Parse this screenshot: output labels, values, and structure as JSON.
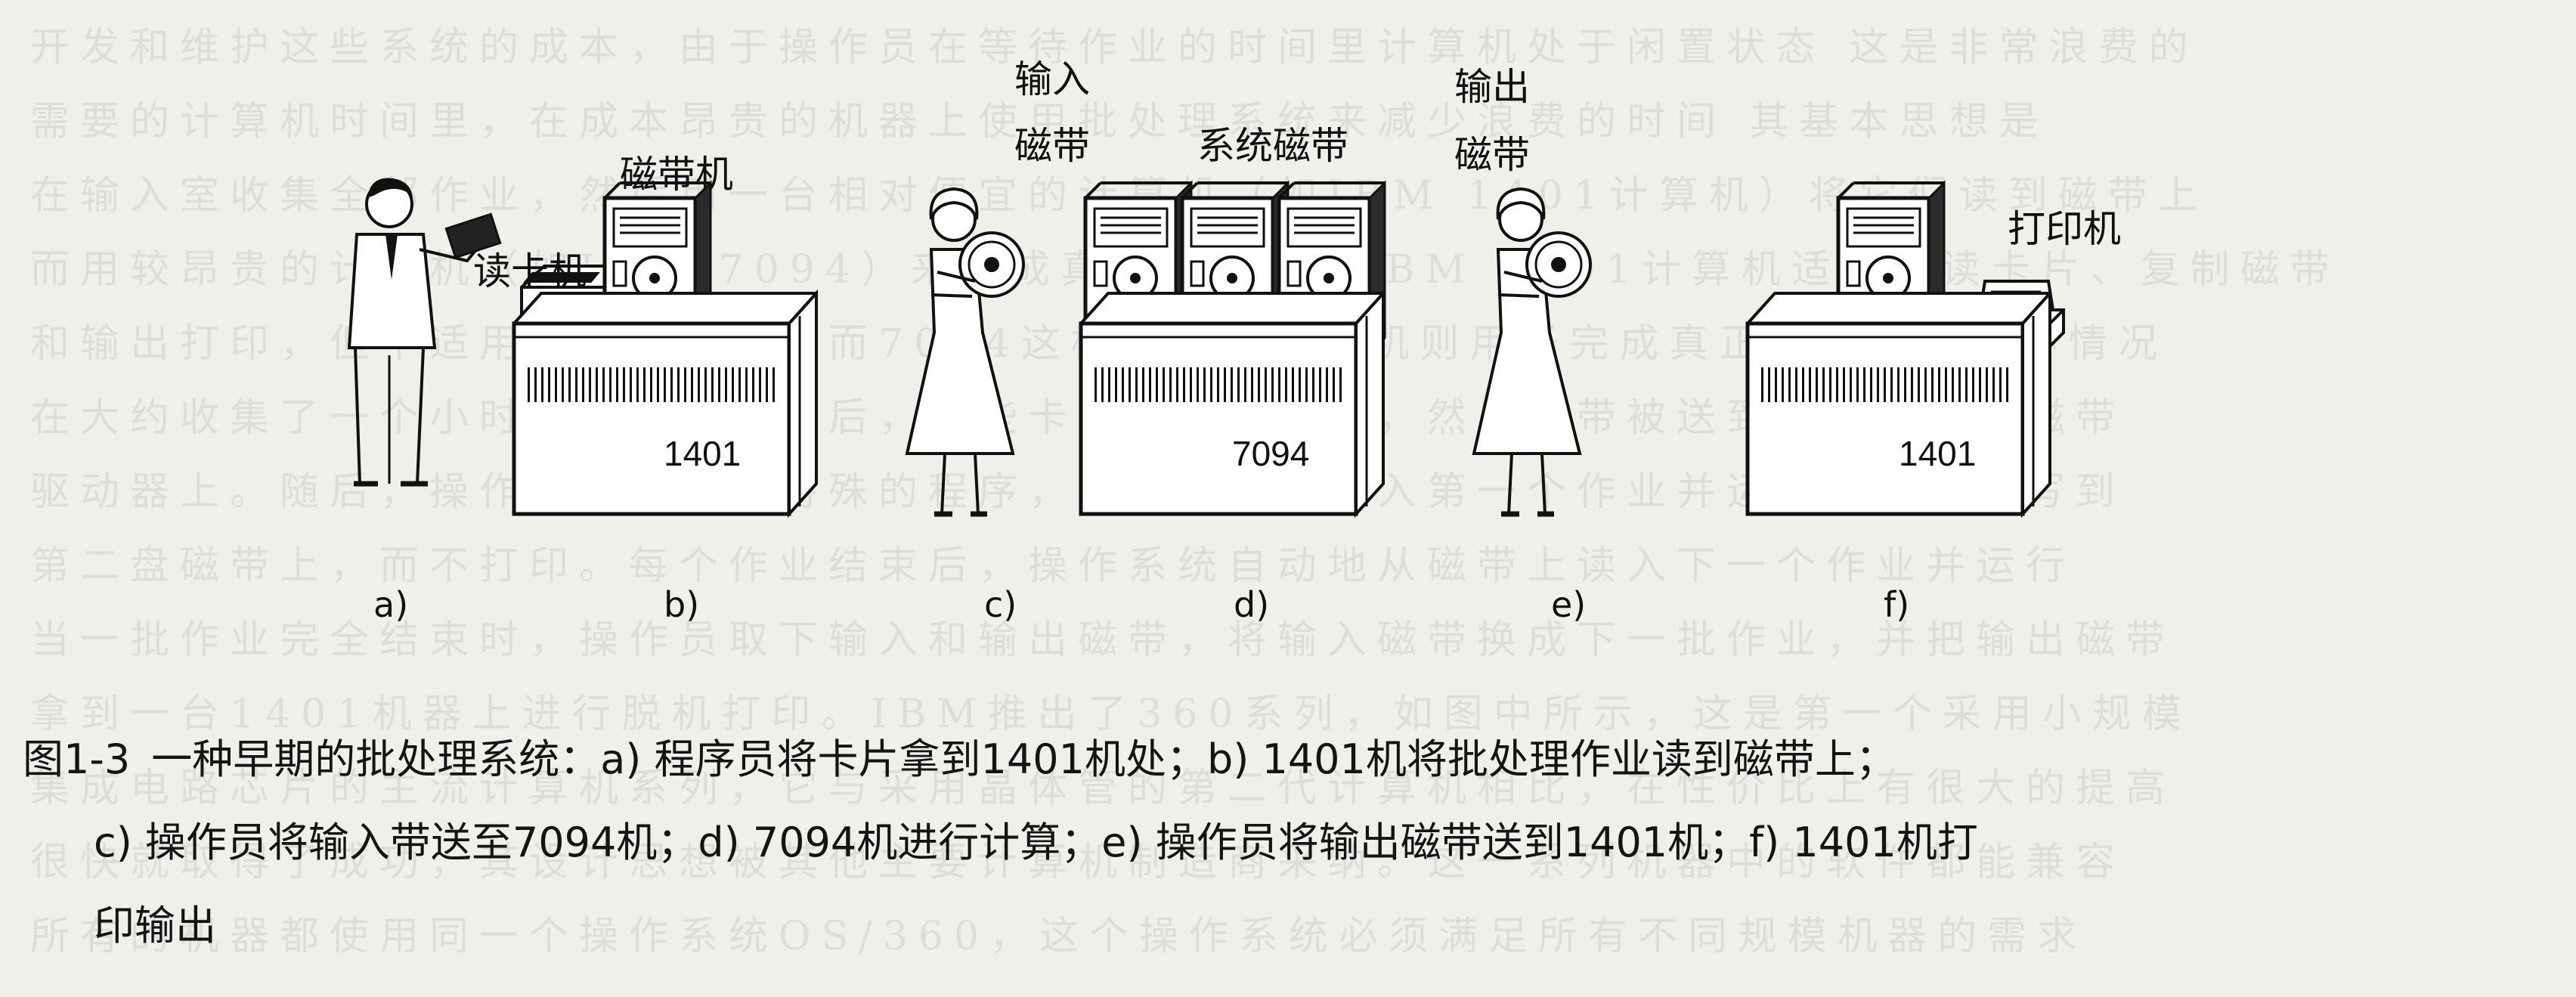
{
  "figure": {
    "labels": {
      "card_reader": "读卡机",
      "tape_drive": "磁带机",
      "input_tape_line1": "输入",
      "input_tape_line2": "磁带",
      "system_tape": "系统磁带",
      "output_tape_line1": "输出",
      "output_tape_line2": "磁带",
      "printer": "打印机"
    },
    "machines": {
      "left": "1401",
      "middle": "7094",
      "right": "1401"
    },
    "panels": [
      "a)",
      "b)",
      "c)",
      "d)",
      "e)",
      "f)"
    ]
  },
  "caption": {
    "number": "图1-3",
    "line1": "一种早期的批处理系统：a) 程序员将卡片拿到1401机处；b) 1401机将批处理作业读到磁带上；",
    "line2": "c) 操作员将输入带送至7094机；d) 7094机进行计算；e) 操作员将输出磁带送到1401机；f) 1401机打",
    "line3": "印输出"
  }
}
